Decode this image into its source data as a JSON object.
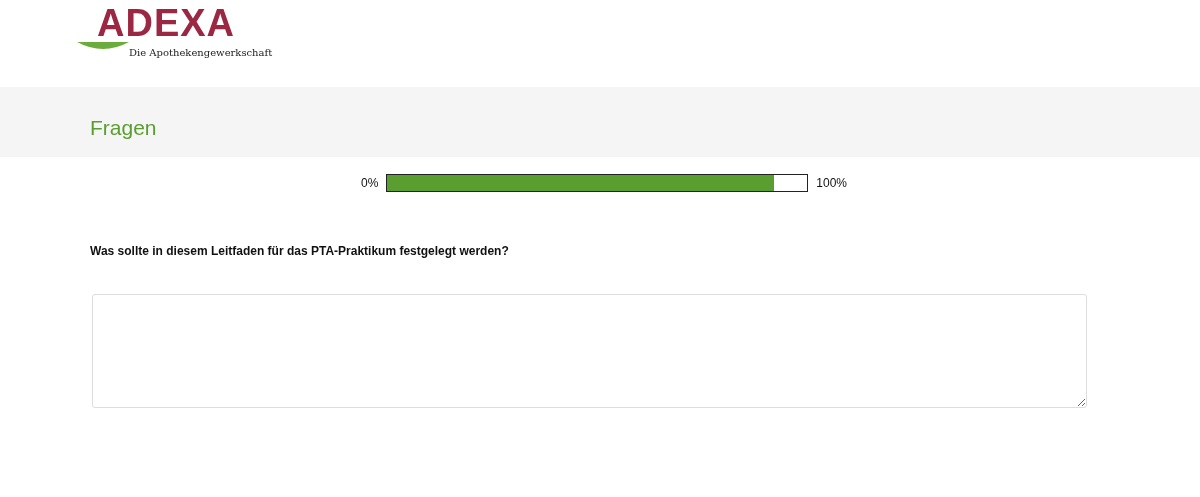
{
  "logo": {
    "name": "ADEXA",
    "tagline": "Die Apothekengewerkschaft"
  },
  "header": {
    "title": "Fragen"
  },
  "progress": {
    "start_label": "0%",
    "end_label": "100%",
    "level": 0.92
  },
  "question": {
    "text": "Was sollte in diesem Leitfaden für das PTA-Praktikum festgelegt werden?"
  }
}
